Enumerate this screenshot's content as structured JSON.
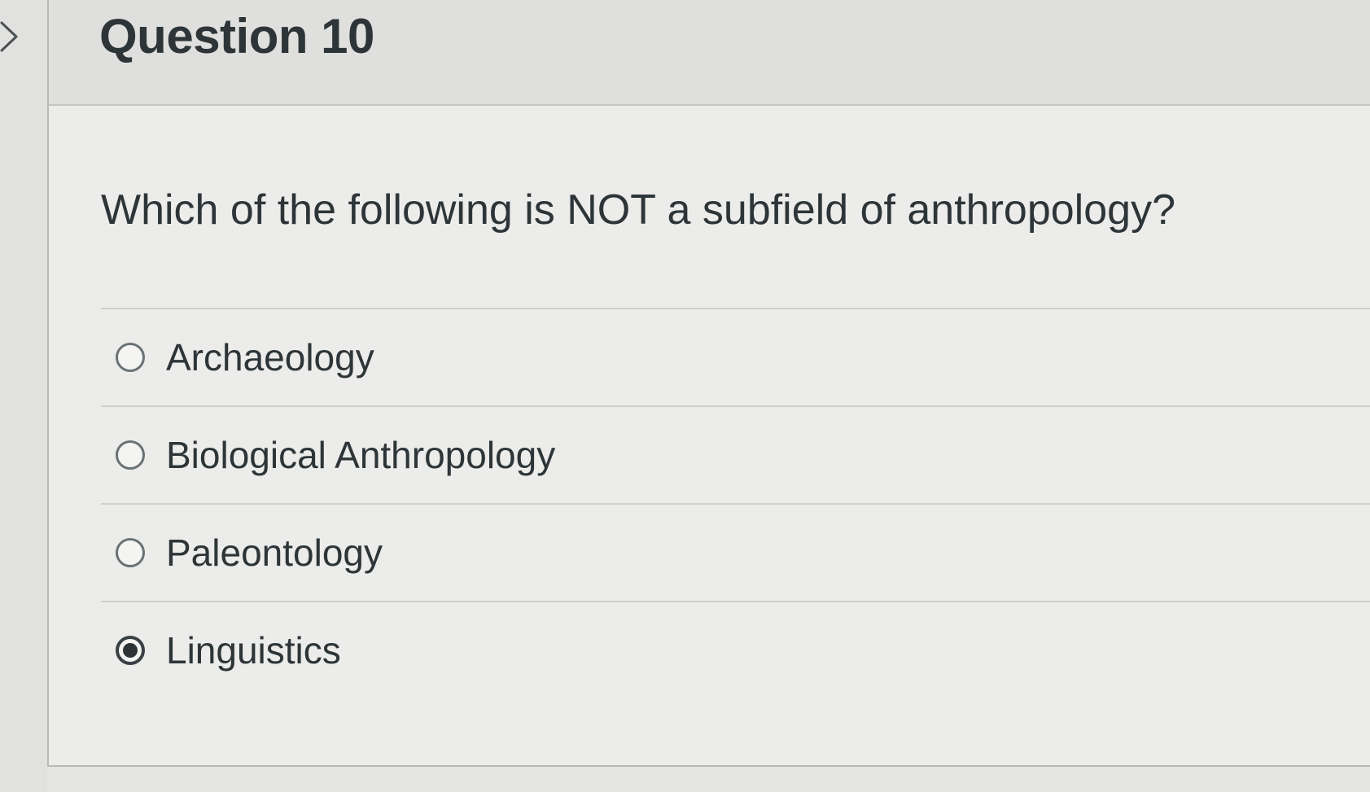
{
  "question": {
    "title": "Question 10",
    "text": "Which of the following is NOT a subfield of anthropology?",
    "answers": [
      {
        "label": "Archaeology",
        "selected": false
      },
      {
        "label": "Biological Anthropology",
        "selected": false
      },
      {
        "label": "Paleontology",
        "selected": false
      },
      {
        "label": "Linguistics",
        "selected": true
      }
    ]
  },
  "icons": {
    "toggle": "chevron-right-icon"
  },
  "colors": {
    "text": "#2d3538",
    "header_bg": "#dfdfdd",
    "radio_border": "#6b7276"
  }
}
